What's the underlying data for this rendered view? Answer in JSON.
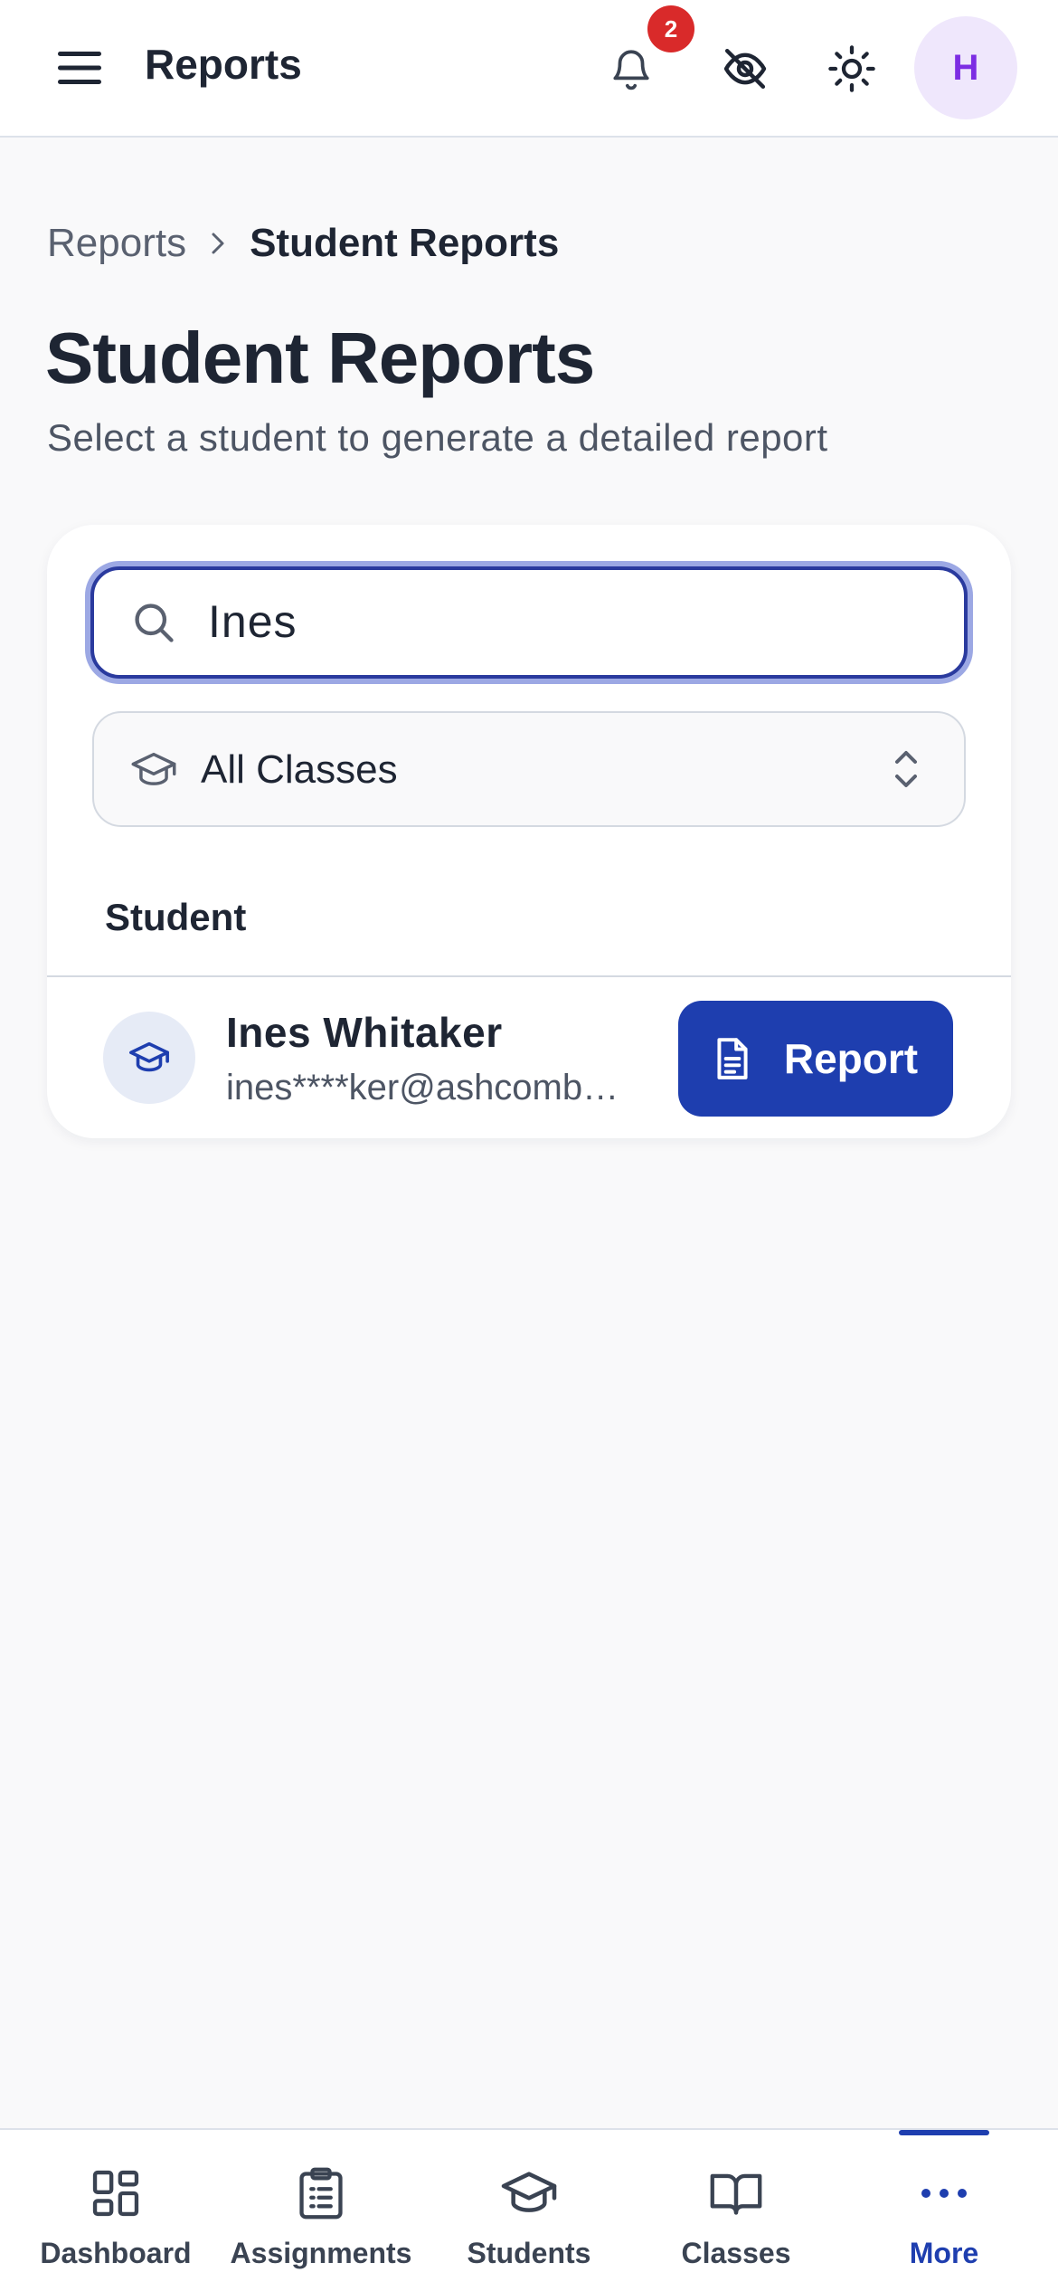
{
  "header": {
    "title": "Reports",
    "notification_count": "2",
    "avatar_initial": "H"
  },
  "breadcrumb": {
    "root": "Reports",
    "current": "Student Reports"
  },
  "page": {
    "title": "Student Reports",
    "subtitle": "Select a student to generate a detailed report"
  },
  "filters": {
    "search_value": "Ines",
    "class_select": "All Classes"
  },
  "table": {
    "column_header": "Student",
    "rows": [
      {
        "name": "Ines Whitaker",
        "email": "ines****ker@ashcombe…",
        "action_label": "Report"
      }
    ]
  },
  "bottom_nav": {
    "items": [
      {
        "label": "Dashboard",
        "icon": "grid-icon"
      },
      {
        "label": "Assignments",
        "icon": "clipboard-icon"
      },
      {
        "label": "Students",
        "icon": "graduation-cap-icon"
      },
      {
        "label": "Classes",
        "icon": "book-icon"
      },
      {
        "label": "More",
        "icon": "more-dots-icon",
        "active": true
      }
    ]
  },
  "colors": {
    "primary": "#1e3eaf",
    "badge": "#d92a2a",
    "avatar_bg": "#efe7fc",
    "avatar_text": "#7c2de3",
    "background": "#f9f9fa"
  }
}
